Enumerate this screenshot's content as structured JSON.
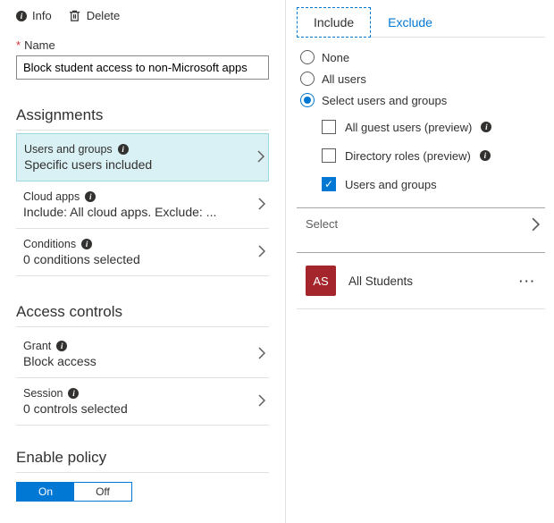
{
  "commands": {
    "info": "Info",
    "delete": "Delete"
  },
  "name_field": {
    "label": "Name",
    "required_marker": "*",
    "value": "Block student access to non-Microsoft apps"
  },
  "sections": {
    "assignments": {
      "title": "Assignments",
      "items": [
        {
          "title": "Users and groups",
          "sub": "Specific users included",
          "selected": true
        },
        {
          "title": "Cloud apps",
          "sub": "Include: All cloud apps. Exclude: ...",
          "selected": false
        },
        {
          "title": "Conditions",
          "sub": "0 conditions selected",
          "selected": false
        }
      ]
    },
    "access_controls": {
      "title": "Access controls",
      "items": [
        {
          "title": "Grant",
          "sub": "Block access"
        },
        {
          "title": "Session",
          "sub": "0 controls selected"
        }
      ]
    },
    "enable_policy": {
      "title": "Enable policy",
      "on": "On",
      "off": "Off",
      "active": "on"
    }
  },
  "right": {
    "tabs": {
      "include": "Include",
      "exclude": "Exclude",
      "active": "include"
    },
    "radios": {
      "none": "None",
      "all_users": "All users",
      "select": "Select users and groups",
      "selected": "select"
    },
    "checks": {
      "guest": {
        "label": "All guest users (preview)",
        "checked": false,
        "info": true
      },
      "roles": {
        "label": "Directory roles (preview)",
        "checked": false,
        "info": true
      },
      "users_groups": {
        "label": "Users and groups",
        "checked": true,
        "info": false
      }
    },
    "select_label": "Select",
    "selected_group": {
      "initials": "AS",
      "name": "All Students"
    }
  }
}
